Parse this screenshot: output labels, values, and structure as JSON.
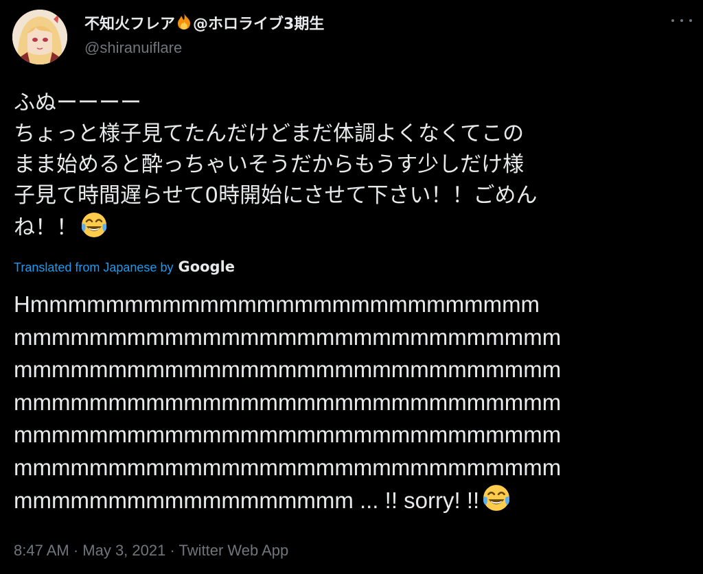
{
  "author": {
    "display_name_prefix": "不知火フレア",
    "display_name_suffix": "@ホロライブ3期生",
    "handle": "@shiranuiflare"
  },
  "tweet": {
    "original_lines": [
      "ふぬーーーー",
      "ちょっと様子見てたんだけどまだ体調よくなくてこの",
      "まま始めると酔っちゃいそうだからもうす少しだけ様",
      "子見て時間遅らせて0時開始にさせて下さい！！ごめん",
      "ね！！"
    ],
    "translation_label": "Translated from Japanese by",
    "translation_provider": "Google",
    "translation_lines": [
      "Hmmmmmmmmmmmmmmmmmmmmmmmmmmm",
      "mmmmmmmmmmmmmmmmmmmmmmmmmmmmm",
      "mmmmmmmmmmmmmmmmmmmmmmmmmmmmm",
      "mmmmmmmmmmmmmmmmmmmmmmmmmmmmm",
      "mmmmmmmmmmmmmmmmmmmmmmmmmmmmm",
      "mmmmmmmmmmmmmmmmmmmmmmmmmmmmm",
      "mmmmmmmmmmmmmmmmmm ... !! sorry! !!"
    ],
    "timestamp": "8:47 AM · May 3, 2021 · Twitter Web App"
  },
  "icons": {
    "fire": "fire-emoji-icon",
    "emoji": "face-with-tears-of-joy-icon",
    "more": "more-options-icon",
    "avatar": "user-avatar"
  },
  "colors": {
    "background": "#000000",
    "text": "#e7e9ea",
    "secondary": "#71767b",
    "link": "#1d9bf0"
  }
}
